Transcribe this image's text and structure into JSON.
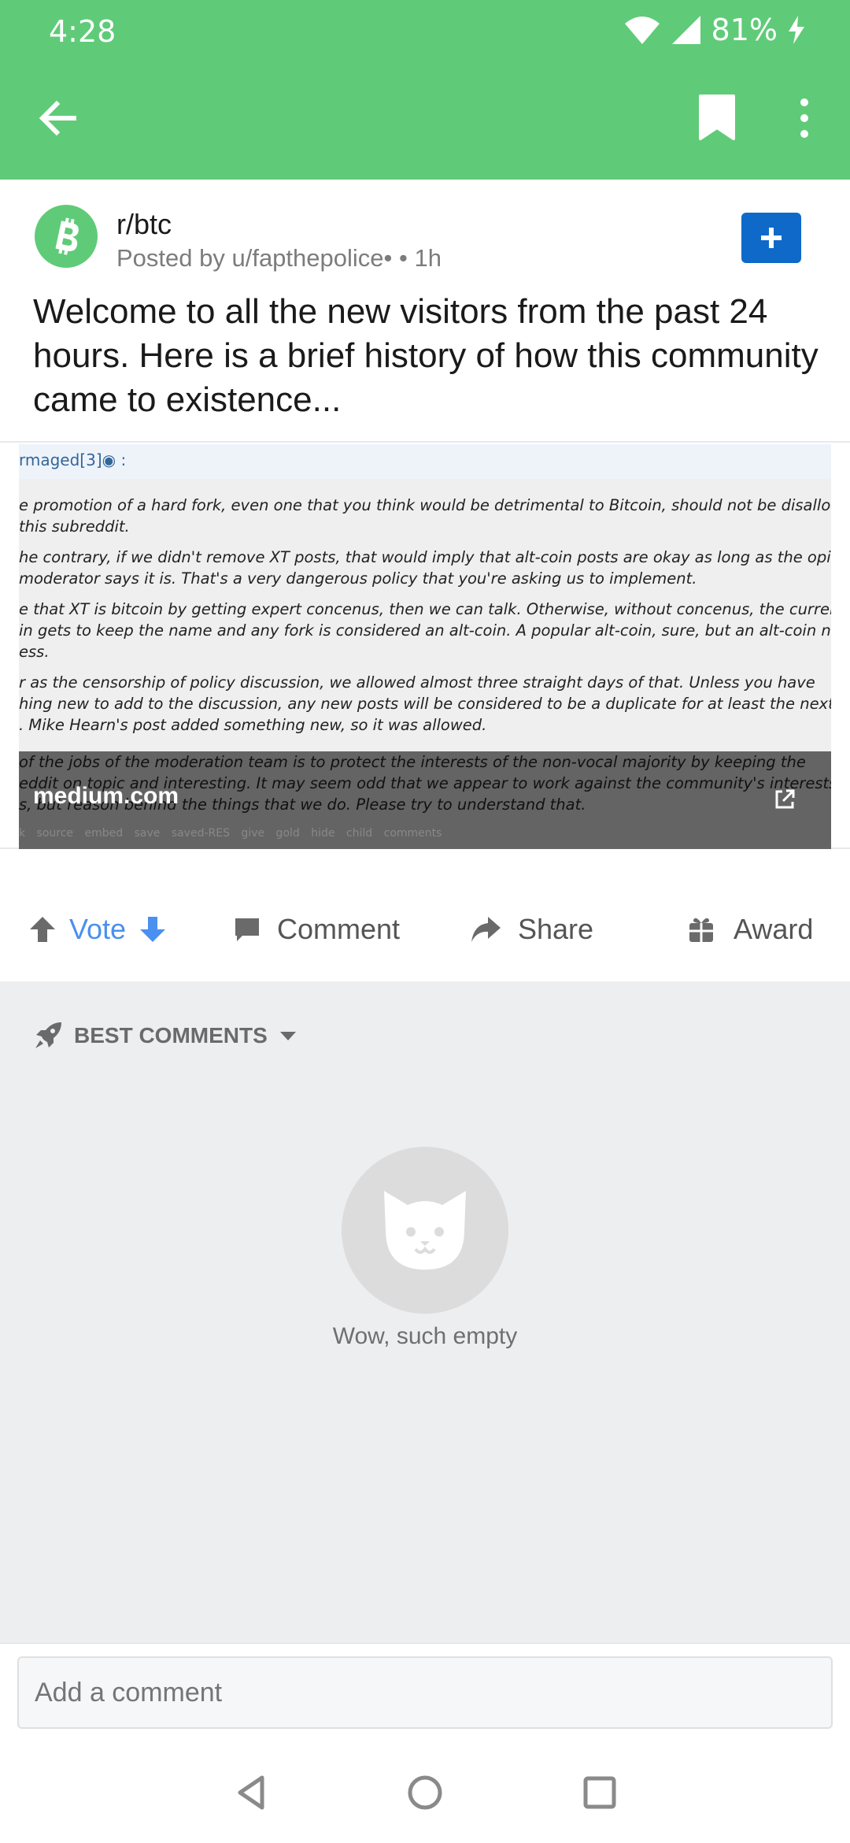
{
  "status_bar": {
    "time": "4:28",
    "battery": "81%"
  },
  "post": {
    "subreddit": "r/btc",
    "posted_by": "Posted by u/fapthepolice• • 1h",
    "title": "Welcome to all the new visitors from the past 24 hours. Here is a brief history of how this community came to existence..."
  },
  "link_preview": {
    "domain": "medium.com",
    "user_line": "rmaged[3]◉ :",
    "paragraphs": [
      "e promotion of a hard fork, even one that you think would be detrimental to Bitcoin, should not be disallow",
      "this subreddit.",
      "he contrary, if we didn't remove XT posts, that would imply that alt-coin posts are okay as long as the opin",
      "moderator says it is. That's a very dangerous policy that you're asking us to implement.",
      "e that XT is bitcoin by getting expert concenus, then we can talk. Otherwise, without concenus, the current",
      "in gets to keep the name and any fork is considered an alt-coin. A popular alt-coin, sure, but an alt-coin no",
      "ess.",
      "r as the censorship of policy discussion, we allowed almost three straight days of that. Unless you have",
      "hing new to add to the discussion, any new posts will be considered to be a duplicate for at least the next",
      ". Mike Hearn's post added something new, so it was allowed."
    ],
    "overlay_paragraphs": [
      "of the jobs of the moderation team is to protect the interests of the non-vocal majority by keeping the",
      "eddit on topic and interesting. It may seem odd that we appear to work against the community's interests",
      "s, but        reason behind the things that we do. Please try to understand that."
    ],
    "footer_links": "k source embed save saved-RES give gold hide child comments"
  },
  "actions": {
    "vote": "Vote",
    "comment": "Comment",
    "share": "Share",
    "award": "Award"
  },
  "comments": {
    "sort_label": "BEST COMMENTS",
    "empty_text": "Wow, such empty"
  },
  "comment_input": {
    "placeholder": "Add a comment"
  },
  "colors": {
    "accent_green": "#5fcb78",
    "join_blue": "#0f69c9",
    "vote_blue": "#4a90f0"
  },
  "icons": {
    "back": "arrow-left-icon",
    "bookmark": "bookmark-icon",
    "more": "more-vertical-icon",
    "subreddit": "bitcoin-icon",
    "join": "plus-icon",
    "upvote": "arrow-up-icon",
    "downvote": "arrow-down-icon",
    "comment": "comment-icon",
    "share": "share-icon",
    "award": "gift-icon",
    "sort": "rocket-icon",
    "empty": "cat-icon"
  }
}
